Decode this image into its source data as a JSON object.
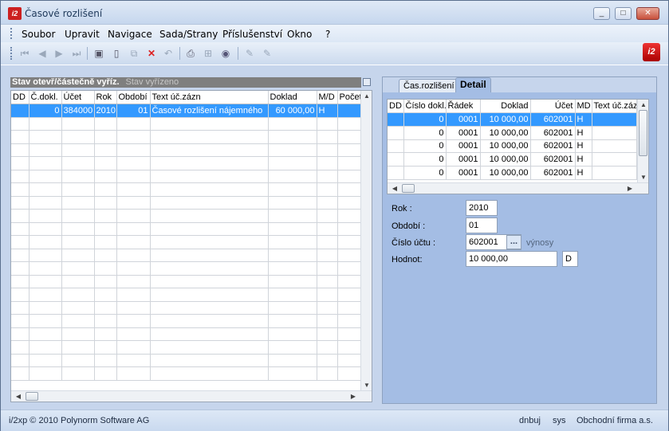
{
  "window": {
    "title": "Časové rozlišení",
    "controls": [
      "_",
      "□",
      "✕"
    ]
  },
  "menu": [
    "Soubor",
    "Upravit",
    "Navigace",
    "Sada/Strany",
    "Příslušenství",
    "Okno",
    "?"
  ],
  "toolbar": {
    "icons": [
      "first-icon",
      "prev-icon",
      "next-icon",
      "last-icon",
      "save-icon",
      "new-icon",
      "copy-icon",
      "delete-icon",
      "undo-icon",
      "print-icon",
      "tree-icon",
      "gear-icon",
      "edit-icon",
      "edit2-icon"
    ]
  },
  "left": {
    "header": "Stav otevř/částečně vyříz.",
    "header_sub": "Stav vyřízeno",
    "columns": [
      "DD",
      "Č.dokl.",
      "Účet",
      "Rok",
      "Období",
      "Text úč.zázn",
      "Doklad",
      "M/D",
      "Počet"
    ],
    "rows": [
      [
        "",
        "0",
        "384000",
        "2010",
        "01",
        "Časové rozlišení nájemného",
        "60 000,00",
        "H",
        ""
      ]
    ]
  },
  "right": {
    "tabs": [
      "Čas.rozlišení",
      "Detail"
    ],
    "active_tab": "Detail",
    "columns": [
      "DD",
      "Číslo dokl.",
      "Řádek",
      "Doklad",
      "Účet",
      "MD",
      "Text úč.záz"
    ],
    "rows": [
      [
        "",
        "0",
        "0001",
        "10 000,00",
        "602001",
        "H",
        ""
      ],
      [
        "",
        "0",
        "0001",
        "10 000,00",
        "602001",
        "H",
        ""
      ],
      [
        "",
        "0",
        "0001",
        "10 000,00",
        "602001",
        "H",
        ""
      ],
      [
        "",
        "0",
        "0001",
        "10 000,00",
        "602001",
        "H",
        ""
      ],
      [
        "",
        "0",
        "0001",
        "10 000,00",
        "602001",
        "H",
        ""
      ]
    ],
    "form": {
      "rok_label": "Rok :",
      "rok": "2010",
      "obdobi_label": "Období :",
      "obdobi": "01",
      "ucet_label": "Číslo účtu :",
      "ucet": "602001",
      "ucet_btn": "...",
      "ucet_hint": "výnosy",
      "hodnot_label": "Hodnot:",
      "hodnot": "10 000,00",
      "md": "D"
    }
  },
  "status": {
    "copyright": "i/2xp © 2010 Polynorm Software AG",
    "user": "dnbuj",
    "db": "sys",
    "firm": "Obchodní firma a.s."
  }
}
